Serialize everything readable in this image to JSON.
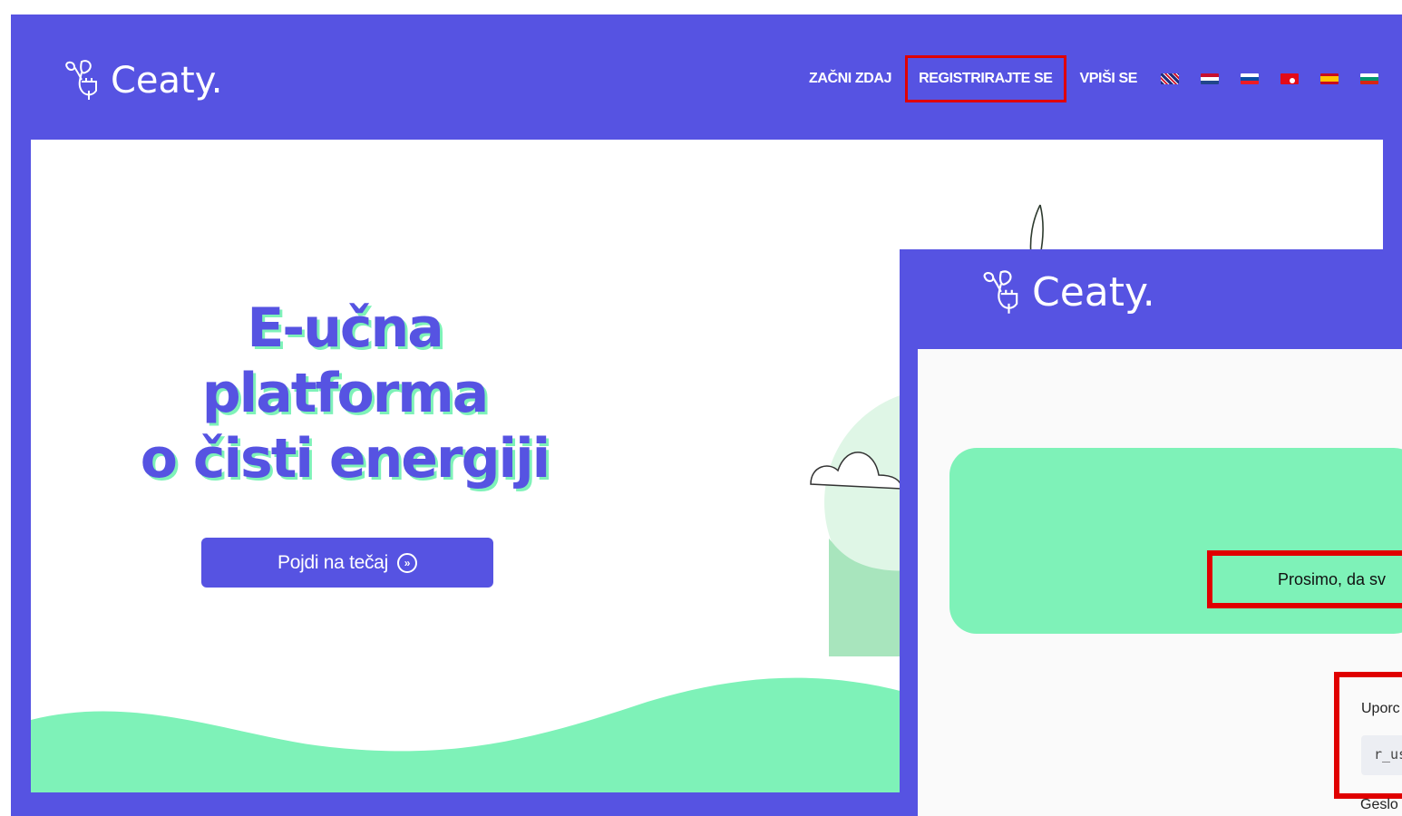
{
  "brand": {
    "name": "Ceaty."
  },
  "nav": {
    "items": [
      {
        "label": "ZAČNI ZDAJ"
      },
      {
        "label": "REGISTRIRAJTE SE"
      },
      {
        "label": "VPIŠI SE"
      }
    ],
    "flags": [
      "uk-flag-icon",
      "netherlands-flag-icon",
      "slovenia-flag-icon",
      "turkey-flag-icon",
      "spain-flag-icon",
      "bulgaria-flag-icon"
    ]
  },
  "hero": {
    "title_line1": "E-učna",
    "title_line2": "platforma",
    "title_line3": "o čisti energiji",
    "cta_label": "Pojdi na tečaj",
    "cta_icon": "double-chevron-right-circle-icon"
  },
  "overlay": {
    "brand": "Ceaty.",
    "notice": "Prosimo, da sv",
    "username_label": "Uporc",
    "username_value": "r_us",
    "password_label": "Geslo"
  },
  "colors": {
    "brand_purple": "#5653e2",
    "mint": "#7ef2b8",
    "highlight_red": "#e00000"
  }
}
